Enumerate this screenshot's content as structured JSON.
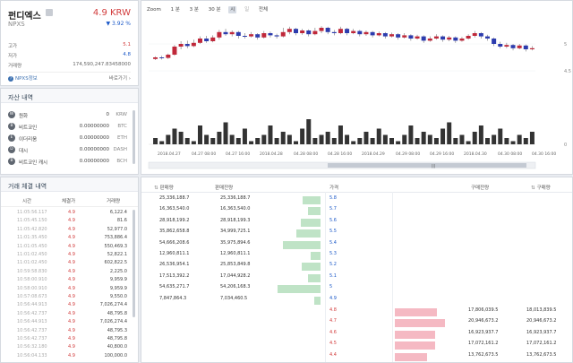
{
  "coin": {
    "name": "펀디엑스",
    "symbol": "NPXS",
    "price": "4.9 KRW",
    "change": "▼ 3.92 %",
    "rows": [
      {
        "label": "고가",
        "value": "5.1",
        "color": "#d23c3c"
      },
      {
        "label": "저가",
        "value": "4.8",
        "color": "#1a58c8"
      },
      {
        "label": "거래량",
        "value": "174,590,247.83458000",
        "color": "#555"
      }
    ],
    "info_link": "NPXS정보",
    "shortcut": "바로가기 ›"
  },
  "assets": {
    "title": "자산 내역",
    "items": [
      {
        "icon": "W",
        "name": "원화",
        "amount": "0",
        "unit": "KRW"
      },
      {
        "icon": "B",
        "name": "비트코인",
        "amount": "0.00000000",
        "unit": "BTC"
      },
      {
        "icon": "E",
        "name": "이더리움",
        "amount": "0.00000000",
        "unit": "ETH"
      },
      {
        "icon": "D",
        "name": "대시",
        "amount": "0.00000000",
        "unit": "DASH"
      },
      {
        "icon": "B",
        "name": "비트코인 캐시",
        "amount": "0.00000000",
        "unit": "BCH"
      }
    ]
  },
  "trades": {
    "title": "거래 체결 내역",
    "headers": [
      "시간",
      "체결가",
      "거래량"
    ],
    "rows": [
      {
        "time": "11:05:56.117",
        "price": "4.9",
        "qty": "6,122.4"
      },
      {
        "time": "11:05:45.150",
        "price": "4.9",
        "qty": "81.6"
      },
      {
        "time": "11:05:42.820",
        "price": "4.9",
        "qty": "52,977.0"
      },
      {
        "time": "11:01:35.450",
        "price": "4.9",
        "qty": "753,886.4"
      },
      {
        "time": "11:01:05.450",
        "price": "4.9",
        "qty": "550,469.3"
      },
      {
        "time": "11:01:02.450",
        "price": "4.9",
        "qty": "52,822.1"
      },
      {
        "time": "11:01:02.450",
        "price": "4.9",
        "qty": "602,822.5"
      },
      {
        "time": "10:59:58.830",
        "price": "4.9",
        "qty": "2,225.0"
      },
      {
        "time": "10:58:00.910",
        "price": "4.9",
        "qty": "9,959.9"
      },
      {
        "time": "10:58:00.910",
        "price": "4.9",
        "qty": "9,959.9"
      },
      {
        "time": "10:57:08.673",
        "price": "4.9",
        "qty": "9,550.0"
      },
      {
        "time": "10:56:44.913",
        "price": "4.9",
        "qty": "7,026,274.4"
      },
      {
        "time": "10:56:42.737",
        "price": "4.9",
        "qty": "48,795.8"
      },
      {
        "time": "10:56:44.913",
        "price": "4.9",
        "qty": "7,026,274.4"
      },
      {
        "time": "10:56:42.737",
        "price": "4.9",
        "qty": "48,795.3"
      },
      {
        "time": "10:56:42.737",
        "price": "4.9",
        "qty": "48,795.8"
      },
      {
        "time": "10:56:32.180",
        "price": "4.9",
        "qty": "40,800.0"
      },
      {
        "time": "10:56:04.133",
        "price": "4.9",
        "qty": "100,000.0"
      }
    ]
  },
  "chart": {
    "zoom_label": "Zoom",
    "zoom_options": [
      "1 분",
      "3 분",
      "30 분",
      "시",
      "일",
      "전체"
    ],
    "zoom_active": "시",
    "y_ticks": [
      "5",
      "4.5",
      "0"
    ],
    "x_ticks": [
      "2018.04.27",
      "04.27 08:00",
      "04.27 16:00",
      "2018.04.28",
      "04.28 08:00",
      "04.28 16:00",
      "2018.04.29",
      "04.29 08:00",
      "04.29 16:00",
      "2018.04.30",
      "04.30 08:00",
      "04.30 16:00"
    ]
  },
  "chart_data": {
    "type": "candlestick",
    "y_range": [
      4.3,
      5.5
    ],
    "candles": [
      [
        4.72,
        4.75,
        4.77,
        4.7
      ],
      [
        4.75,
        4.74,
        4.78,
        4.71
      ],
      [
        4.74,
        4.8,
        4.82,
        4.72
      ],
      [
        4.8,
        4.95,
        4.98,
        4.78
      ],
      [
        4.95,
        5.0,
        5.05,
        4.9
      ],
      [
        5.0,
        4.96,
        5.06,
        4.92
      ],
      [
        4.96,
        5.02,
        5.08,
        4.94
      ],
      [
        5.02,
        5.1,
        5.14,
        5.0
      ],
      [
        5.1,
        5.05,
        5.15,
        5.02
      ],
      [
        5.05,
        5.12,
        5.16,
        5.03
      ],
      [
        5.12,
        5.22,
        5.26,
        5.08
      ],
      [
        5.22,
        5.18,
        5.28,
        5.15
      ],
      [
        5.18,
        5.22,
        5.25,
        5.14
      ],
      [
        5.22,
        5.15,
        5.24,
        5.1
      ],
      [
        5.15,
        5.14,
        5.2,
        5.1
      ],
      [
        5.14,
        5.18,
        5.22,
        5.12
      ],
      [
        5.18,
        5.12,
        5.2,
        5.08
      ],
      [
        5.12,
        5.2,
        5.24,
        5.1
      ],
      [
        5.2,
        5.16,
        5.23,
        5.12
      ],
      [
        5.16,
        5.14,
        5.19,
        5.1
      ],
      [
        5.14,
        5.22,
        5.3,
        5.12
      ],
      [
        5.22,
        5.28,
        5.32,
        5.18
      ],
      [
        5.28,
        5.2,
        5.3,
        5.16
      ],
      [
        5.2,
        5.25,
        5.28,
        5.17
      ],
      [
        5.25,
        5.18,
        5.27,
        5.14
      ],
      [
        5.18,
        5.24,
        5.3,
        5.16
      ],
      [
        5.24,
        5.3,
        5.33,
        5.2
      ],
      [
        5.3,
        5.22,
        5.32,
        5.18
      ],
      [
        5.22,
        5.2,
        5.26,
        5.16
      ],
      [
        5.2,
        5.28,
        5.32,
        5.18
      ],
      [
        5.28,
        5.2,
        5.3,
        5.16
      ],
      [
        5.2,
        5.24,
        5.28,
        5.18
      ],
      [
        5.24,
        5.18,
        5.26,
        5.14
      ],
      [
        5.18,
        5.22,
        5.25,
        5.15
      ],
      [
        5.22,
        5.16,
        5.24,
        5.12
      ],
      [
        5.16,
        5.2,
        5.23,
        5.14
      ],
      [
        5.2,
        5.14,
        5.22,
        5.1
      ],
      [
        5.14,
        5.18,
        5.21,
        5.12
      ],
      [
        5.18,
        5.12,
        5.2,
        5.08
      ],
      [
        5.12,
        5.16,
        5.2,
        5.1
      ],
      [
        5.16,
        5.1,
        5.18,
        5.06
      ],
      [
        5.1,
        5.14,
        5.17,
        5.08
      ],
      [
        5.14,
        5.06,
        5.16,
        5.02
      ],
      [
        5.06,
        5.1,
        5.14,
        5.04
      ],
      [
        5.1,
        5.14,
        5.18,
        5.08
      ],
      [
        5.14,
        5.08,
        5.16,
        5.04
      ],
      [
        5.08,
        5.12,
        5.15,
        5.05
      ],
      [
        5.12,
        5.06,
        5.14,
        5.02
      ],
      [
        5.06,
        5.1,
        5.13,
        5.04
      ],
      [
        5.1,
        5.15,
        5.18,
        5.08
      ],
      [
        5.15,
        5.2,
        5.24,
        5.12
      ],
      [
        5.2,
        5.14,
        5.22,
        5.1
      ],
      [
        5.14,
        5.1,
        5.17,
        5.06
      ],
      [
        5.1,
        5.0,
        5.12,
        4.96
      ],
      [
        5.0,
        4.95,
        5.04,
        4.92
      ],
      [
        4.95,
        4.98,
        5.02,
        4.92
      ],
      [
        4.98,
        4.92,
        5.0,
        4.88
      ],
      [
        4.92,
        4.97,
        5.0,
        4.9
      ],
      [
        4.97,
        4.9,
        4.99,
        4.86
      ],
      [
        4.9,
        4.92,
        4.96,
        4.88
      ]
    ],
    "volumes": [
      2,
      1,
      3,
      5,
      4,
      2,
      1,
      6,
      3,
      2,
      4,
      7,
      3,
      2,
      5,
      1,
      2,
      3,
      6,
      2,
      4,
      3,
      1,
      5,
      8,
      2,
      3,
      4,
      2,
      6,
      3,
      1,
      2,
      4,
      2,
      5,
      3,
      2,
      1,
      3,
      6,
      2,
      4,
      3,
      2,
      5,
      7,
      2,
      3,
      1,
      4,
      6,
      2,
      3,
      5,
      2,
      1,
      3,
      2,
      4
    ]
  },
  "orderbook": {
    "headers": {
      "ask_qty": "판매량",
      "ask_chg": "판매잔량",
      "price": "가격",
      "bid_chg": "구매잔량",
      "bid_qty": "구매량"
    },
    "asks": [
      {
        "qty": "25,336,188.7",
        "remain": "25,336,188.7",
        "price": "5.8",
        "ratio": 0.28
      },
      {
        "qty": "16,363,540.0",
        "remain": "16,363,540.0",
        "price": "5.7",
        "ratio": 0.2
      },
      {
        "qty": "28,918,199.2",
        "remain": "28,918,199.3",
        "price": "5.6",
        "ratio": 0.32
      },
      {
        "qty": "35,862,658.8",
        "remain": "34,999,725.1",
        "price": "5.5",
        "ratio": 0.38
      },
      {
        "qty": "54,666,208.6",
        "remain": "35,975,894.6",
        "price": "5.4",
        "ratio": 0.6
      },
      {
        "qty": "12,960,811.1",
        "remain": "12,960,811.1",
        "price": "5.3",
        "ratio": 0.16
      },
      {
        "qty": "26,536,954.1",
        "remain": "25,853,849.8",
        "price": "5.2",
        "ratio": 0.3
      },
      {
        "qty": "17,513,392.2",
        "remain": "17,044,928.2",
        "price": "5.1",
        "ratio": 0.2
      },
      {
        "qty": "54,635,271.7",
        "remain": "54,206,168.3",
        "price": "5",
        "ratio": 0.68
      },
      {
        "qty": "7,847,864.3",
        "remain": "7,034,460.5",
        "price": "4.9",
        "ratio": 0.1
      }
    ],
    "bids": [
      {
        "price": "4.8",
        "remain": "17,806,039.5",
        "qty": "18,013,839.5",
        "ratio": 0.62
      },
      {
        "price": "4.7",
        "remain": "20,946,673.2",
        "qty": "20,946,673.2",
        "ratio": 0.74
      },
      {
        "price": "4.6",
        "remain": "16,923,937.7",
        "qty": "16,923,937.7",
        "ratio": 0.6
      },
      {
        "price": "4.5",
        "remain": "17,072,161.2",
        "qty": "17,072,161.2",
        "ratio": 0.6
      },
      {
        "price": "4.4",
        "remain": "13,762,673.5",
        "qty": "13,762,673.5",
        "ratio": 0.48
      }
    ]
  }
}
